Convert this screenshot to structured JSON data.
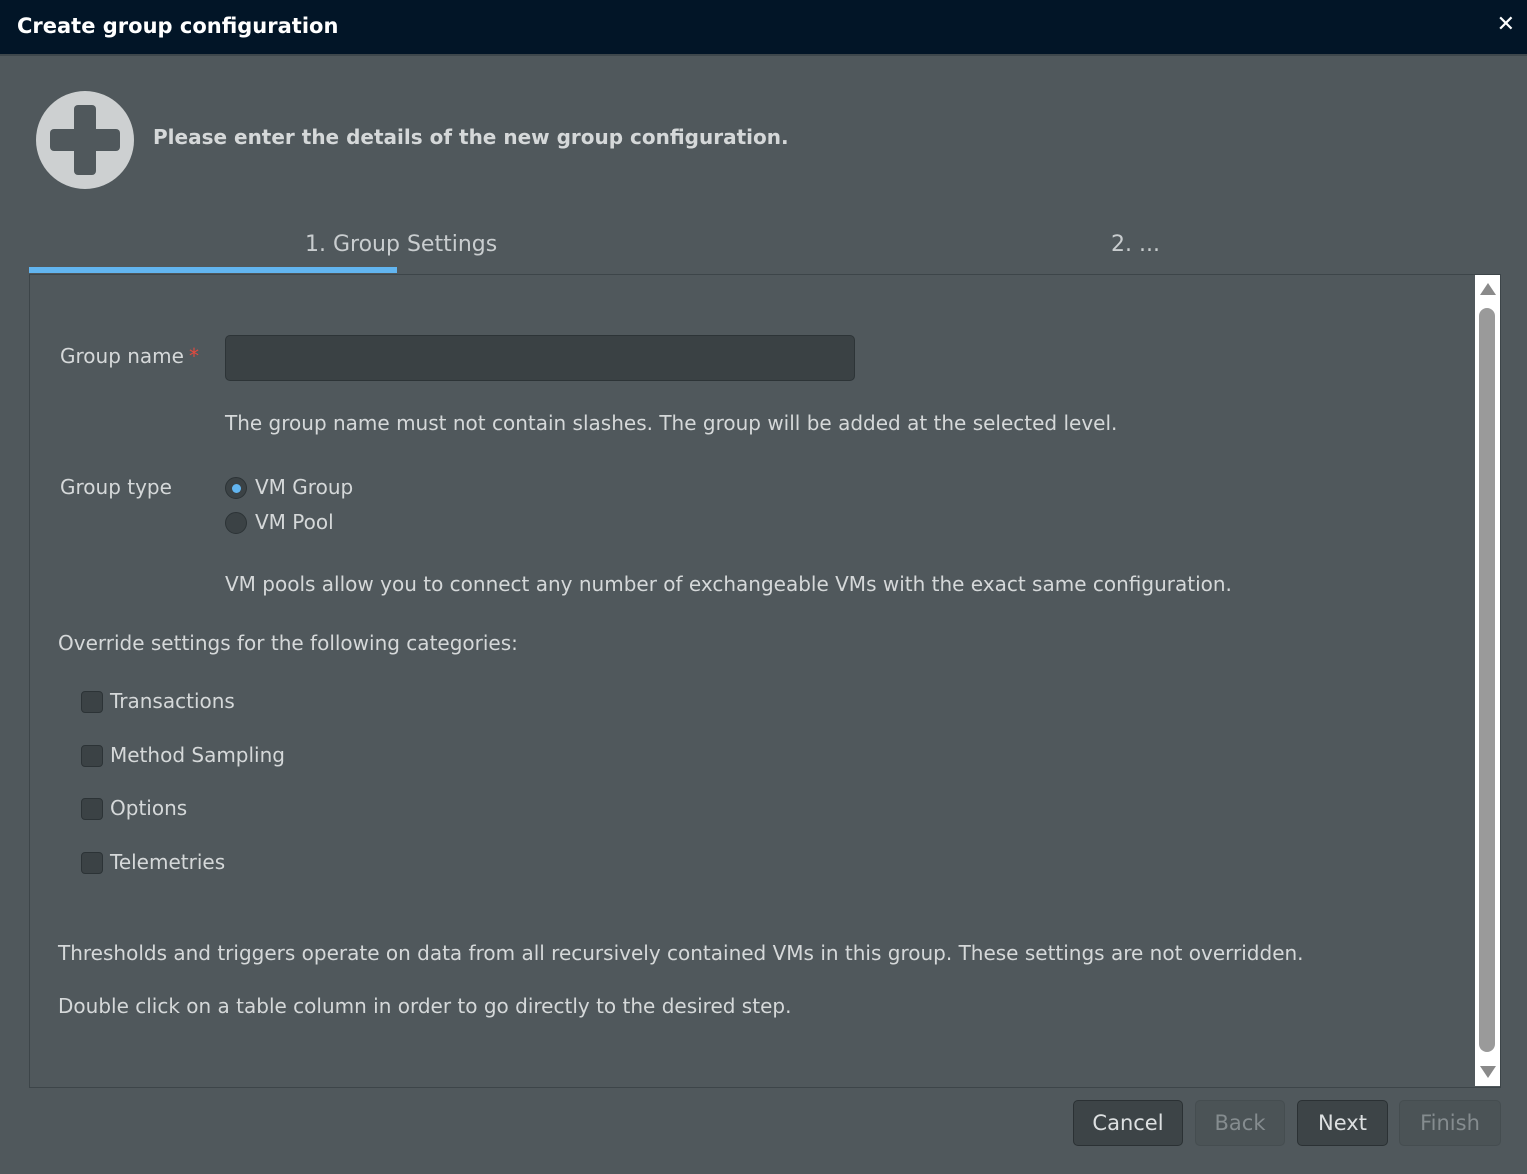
{
  "window": {
    "title": "Create group configuration",
    "close_icon": "close-icon"
  },
  "header": {
    "icon": "plus-circle-icon",
    "text": "Please enter the details of the new group configuration."
  },
  "tabs": [
    {
      "label": "1. Group Settings",
      "active": true
    },
    {
      "label": "2. ..."
    }
  ],
  "form": {
    "group_name_label": "Group name",
    "required_mark": "*",
    "group_name_value": "",
    "group_name_hint": "The group name must not contain slashes. The group will be added at the selected level.",
    "group_type_label": "Group type",
    "group_type_options": [
      {
        "label": "VM Group",
        "selected": true
      },
      {
        "label": "VM Pool",
        "selected": false
      }
    ],
    "group_type_hint": "VM pools allow you to connect any number of exchangeable VMs with the exact same configuration.",
    "override_label": "Override settings for the following categories:",
    "categories": [
      {
        "label": "Transactions",
        "checked": false
      },
      {
        "label": "Method Sampling",
        "checked": false
      },
      {
        "label": "Options",
        "checked": false
      },
      {
        "label": "Telemetries",
        "checked": false
      }
    ],
    "note1": "Thresholds and triggers operate on data from all recursively contained VMs in this group. These settings are not overridden.",
    "note2": "Double click on a table column in order to go directly to the desired step."
  },
  "buttons": {
    "cancel": "Cancel",
    "back": "Back",
    "next": "Next",
    "finish": "Finish"
  },
  "colors": {
    "accent": "#62b5f0",
    "titlebar": "#021527",
    "background": "#50585c",
    "required": "#e34a3f"
  }
}
